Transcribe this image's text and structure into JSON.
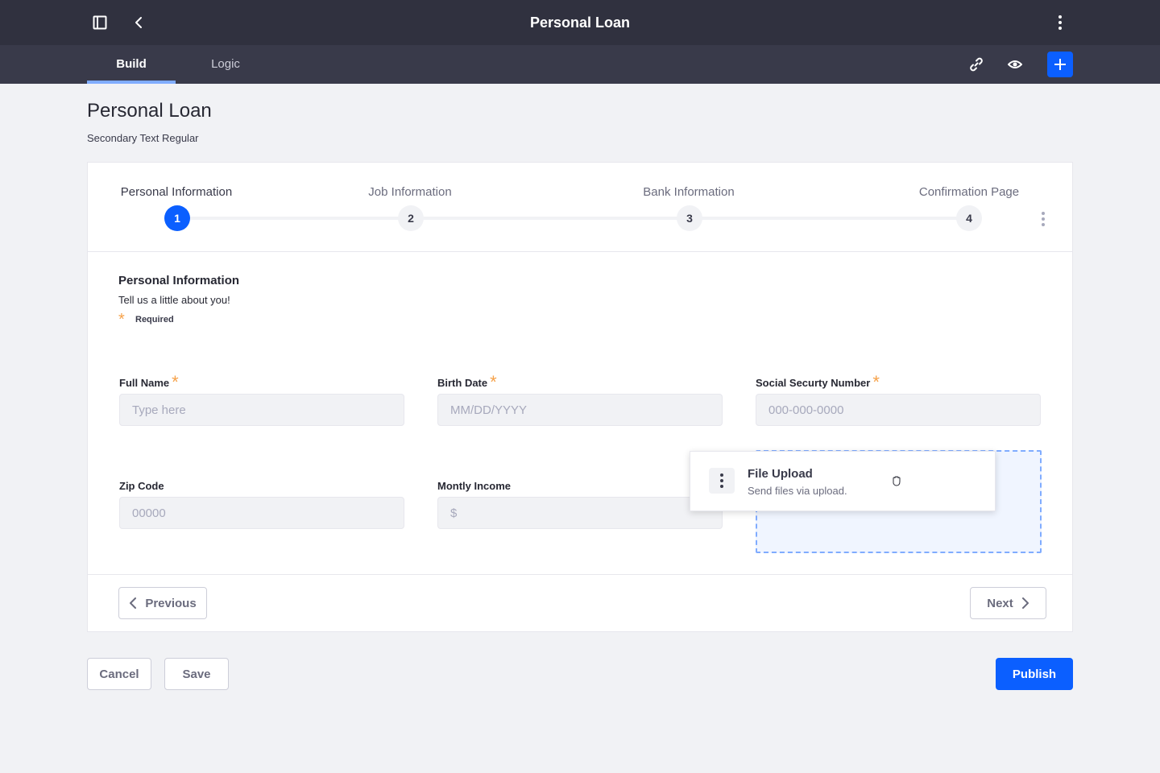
{
  "header": {
    "title": "Personal Loan",
    "icons": {
      "sidebar": "sidebar-toggle-icon",
      "back": "back-arrow-icon",
      "more": "vertical-kebab-icon"
    }
  },
  "tabs": [
    {
      "label": "Build",
      "active": true
    },
    {
      "label": "Logic",
      "active": false
    }
  ],
  "toolbar": {
    "icons": [
      "link-icon",
      "eye-icon",
      "plus-icon"
    ]
  },
  "page": {
    "title": "Personal Loan",
    "subtitle": "Secondary Text Regular"
  },
  "steps": [
    {
      "label": "Personal Information",
      "number": "1",
      "active": true
    },
    {
      "label": "Job Information",
      "number": "2",
      "active": false
    },
    {
      "label": "Bank Information",
      "number": "3",
      "active": false
    },
    {
      "label": "Confirmation Page",
      "number": "4",
      "active": false
    }
  ],
  "section": {
    "title": "Personal Information",
    "description": "Tell us a little about you!",
    "required_star": "*",
    "required_label": "Required"
  },
  "fields": {
    "full_name": {
      "label": "Full Name",
      "placeholder": "Type here",
      "required": true
    },
    "birth_date": {
      "label": "Birth Date",
      "placeholder": "MM/DD/YYYY",
      "required": true
    },
    "ssn": {
      "label": "Social Securty Number",
      "placeholder": "000-000-0000",
      "required": true
    },
    "zip": {
      "label": "Zip Code",
      "placeholder": "00000",
      "required": false
    },
    "income": {
      "label": "Montly Income",
      "placeholder": "$",
      "required": false
    }
  },
  "drag_item": {
    "title": "File Upload",
    "description": "Send files via upload."
  },
  "nav": {
    "previous": "Previous",
    "next": "Next"
  },
  "actions": {
    "cancel": "Cancel",
    "save": "Save",
    "publish": "Publish"
  },
  "colors": {
    "primary": "#0b5fff",
    "header_bg": "#30313f",
    "subbar_bg": "#393a4a",
    "required": "#f6a24a",
    "dropzone_border": "#80acff"
  }
}
